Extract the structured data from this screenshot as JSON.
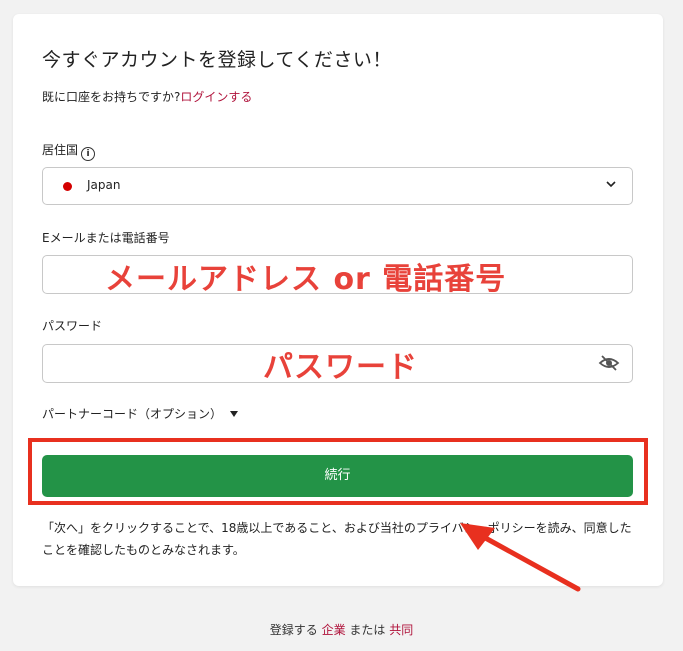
{
  "form": {
    "title": "今すぐアカウントを登録してください！",
    "login_prompt": "既に口座をお持ちですか?",
    "login_link": "ログインする",
    "residence_label": "居住国",
    "residence_value": "Japan",
    "email_label": "Eメールまたは電話番号",
    "email_annotation": "メールアドレス or 電話番号",
    "password_label": "パスワード",
    "password_annotation": "パスワード",
    "partner_code_label": "パートナーコード（オプション）",
    "continue_button": "続行",
    "disclaimer": "「次へ」をクリックすることで、18歳以上であること、および当社のプライバシーポリシーを読み、同意したことを確認したものとみなされます。"
  },
  "footer": {
    "prefix": "登録する",
    "corporate_link": "企業",
    "middle": "または",
    "joint_link": "共同"
  },
  "colors": {
    "accent_link": "#b0143c",
    "button_green": "#239347",
    "annotation_red": "#e8301f",
    "flag_red": "#d40000"
  },
  "icons": [
    "info-icon",
    "chevron-down-icon",
    "eye-off-icon",
    "caret-down-icon",
    "annotation-arrow"
  ]
}
